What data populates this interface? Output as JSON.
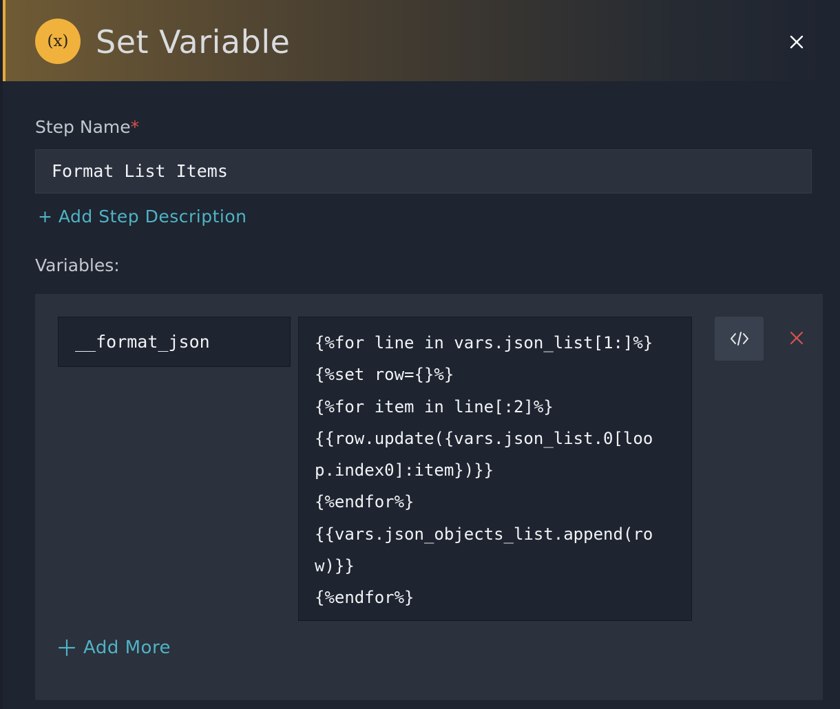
{
  "header": {
    "icon_text": "(x)",
    "title": "Set Variable"
  },
  "form": {
    "step_name_label": "Step Name",
    "required_mark": "*",
    "step_name_value": "Format List Items",
    "add_description_label": "+ Add Step Description",
    "variables_label": "Variables:"
  },
  "variables": {
    "items": [
      {
        "name": "__format_json",
        "value": "{%for line in vars.json_list[1:]%}\n{%set row={}%}\n{%for item in line[:2]%}\n{{row.update({vars.json_list.0[loo\np.index0]:item})}}\n{%endfor%}\n{{vars.json_objects_list.append(ro\nw)}}\n{%endfor%}"
      }
    ],
    "add_more_label": "Add More"
  },
  "colors": {
    "accent": "#f0b23d",
    "link": "#4fb3c4",
    "danger": "#d9534f",
    "background": "#1e2430",
    "panel": "#2b313d"
  },
  "icons": {
    "header": "variable-icon",
    "close": "close-icon",
    "code": "code-icon",
    "remove": "remove-icon",
    "add": "plus-icon"
  }
}
